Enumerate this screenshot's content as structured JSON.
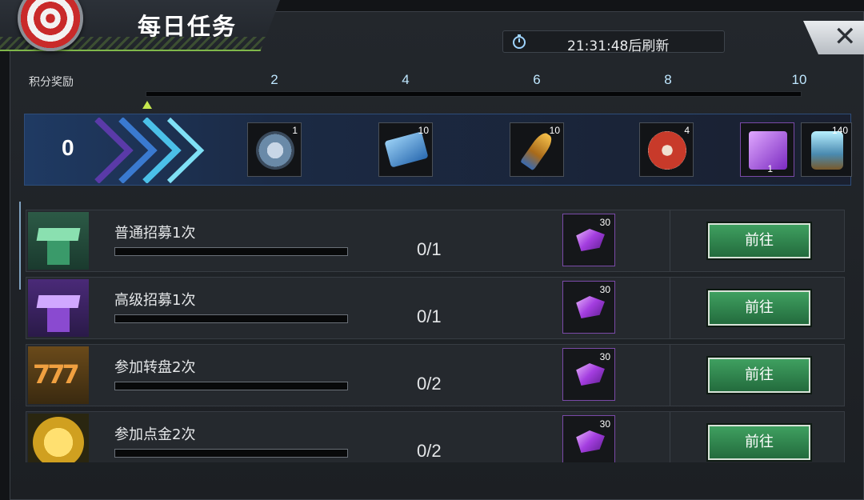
{
  "header": {
    "title": "每日任务",
    "refresh_timer": "21:31:48后刷新"
  },
  "points": {
    "label": "积分奖励",
    "current": "0",
    "progress_fraction": 0,
    "milestones": [
      "2",
      "4",
      "6",
      "8",
      "10"
    ]
  },
  "rewards": [
    {
      "icon": "silver-coin-icon",
      "count": "1"
    },
    {
      "icon": "ticket-card-icon",
      "count": "10"
    },
    {
      "icon": "bullet-ammo-icon",
      "count": "10"
    },
    {
      "icon": "poker-chip-icon",
      "count": "4"
    },
    {
      "icon": "purple-silhouette-card-icon",
      "count": "1"
    },
    {
      "icon": "trophy-icon",
      "count": "140"
    }
  ],
  "tasks": [
    {
      "name": "普通招募1次",
      "progress": "0/1",
      "reward_count": "30",
      "button": "前往",
      "icon": "green-recruit-icon"
    },
    {
      "name": "高级招募1次",
      "progress": "0/1",
      "reward_count": "30",
      "button": "前往",
      "icon": "purple-recruit-icon"
    },
    {
      "name": "参加转盘2次",
      "progress": "0/2",
      "reward_count": "30",
      "button": "前往",
      "icon": "slot-777-icon"
    },
    {
      "name": "参加点金2次",
      "progress": "0/2",
      "reward_count": "30",
      "button": "前往",
      "icon": "gold-diamond-coin-icon"
    }
  ],
  "colors": {
    "accent_green": "#8cd04a",
    "button_green": "#2f8a4e",
    "gem_purple": "#a43ee0"
  }
}
